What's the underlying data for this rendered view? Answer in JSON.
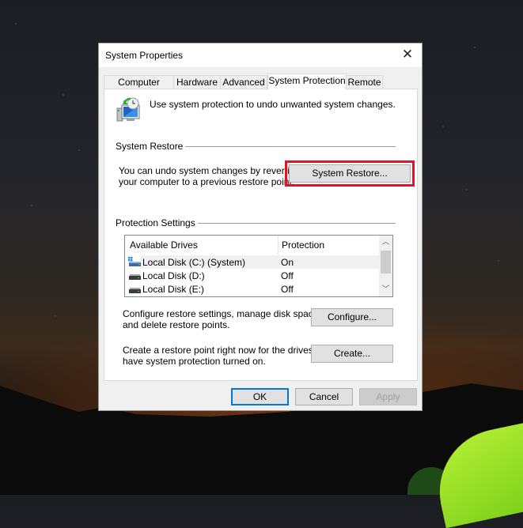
{
  "window": {
    "title": "System Properties",
    "close_icon": "close-icon"
  },
  "tabs": [
    {
      "label": "Computer Name",
      "active": false
    },
    {
      "label": "Hardware",
      "active": false
    },
    {
      "label": "Advanced",
      "active": false
    },
    {
      "label": "System Protection",
      "active": true
    },
    {
      "label": "Remote",
      "active": false
    }
  ],
  "intro": {
    "icon": "system-protection-icon",
    "text": "Use system protection to undo unwanted system changes."
  },
  "system_restore": {
    "group_label": "System Restore",
    "description_line1": "You can undo system changes by reverting",
    "description_line2": "your computer to a previous restore point.",
    "button_label": "System Restore...",
    "highlight_color": "#e81123"
  },
  "protection_settings": {
    "group_label": "Protection Settings",
    "columns": [
      "Available Drives",
      "Protection"
    ],
    "drives": [
      {
        "name": "Local Disk (C:) (System)",
        "protection": "On",
        "icon": "system-drive-icon",
        "selected": true
      },
      {
        "name": "Local Disk (D:)",
        "protection": "Off",
        "icon": "drive-icon",
        "selected": false
      },
      {
        "name": "Local Disk (E:)",
        "protection": "Off",
        "icon": "drive-icon",
        "selected": false
      }
    ],
    "configure_text_line1": "Configure restore settings, manage disk space,",
    "configure_text_line2": "and delete restore points.",
    "configure_button": "Configure...",
    "create_text_line1": "Create a restore point right now for the drives that",
    "create_text_line2": "have system protection turned on.",
    "create_button": "Create..."
  },
  "footer": {
    "ok": "OK",
    "cancel": "Cancel",
    "apply": "Apply"
  },
  "colors": {
    "accent": "#0078d7",
    "highlight": "#e81123"
  }
}
